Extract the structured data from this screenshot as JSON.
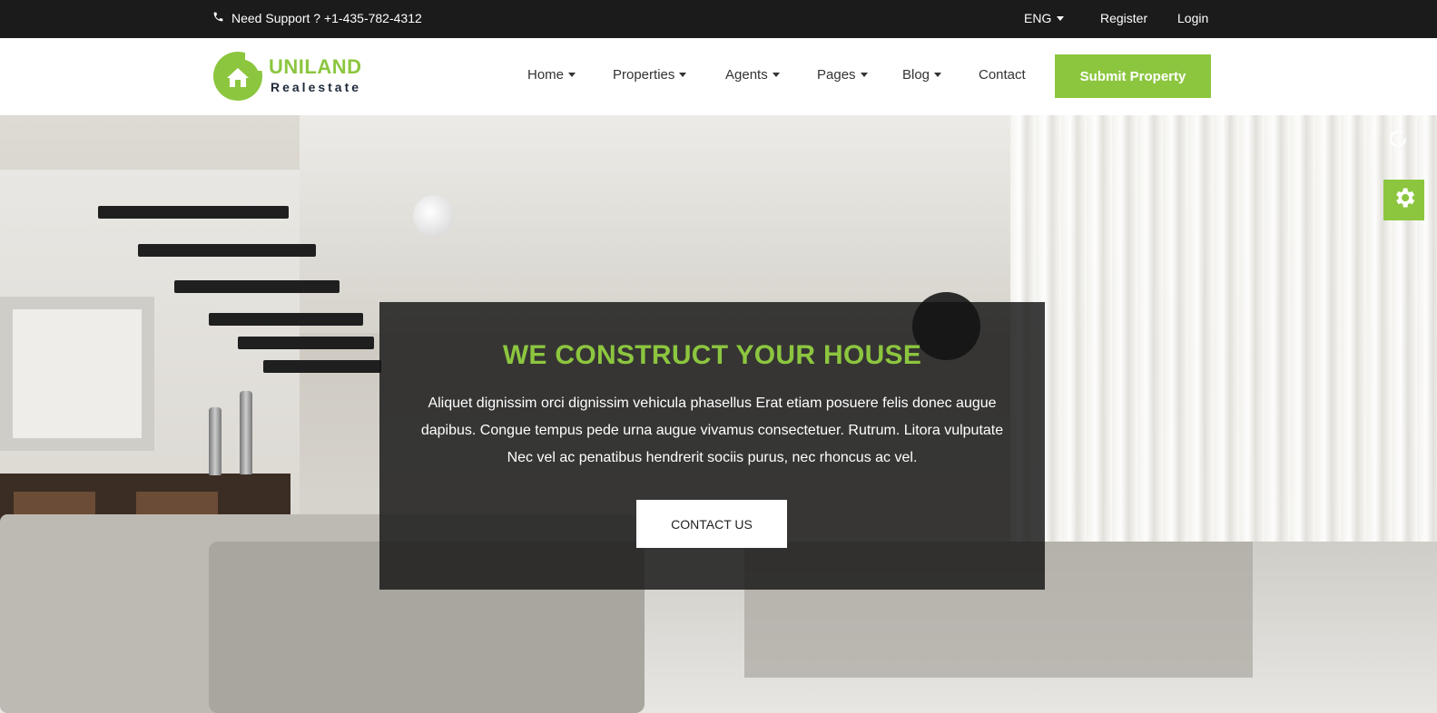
{
  "topbar": {
    "support_text": "Need Support ? +1-435-782-4312",
    "language": "ENG",
    "register": "Register",
    "login": "Login"
  },
  "logo": {
    "name": "UNILAND",
    "sub": "Realestate"
  },
  "nav": {
    "items": [
      {
        "label": "Home",
        "dropdown": true
      },
      {
        "label": "Properties",
        "dropdown": true
      },
      {
        "label": "Agents",
        "dropdown": true
      },
      {
        "label": "Pages",
        "dropdown": true
      },
      {
        "label": "Blog",
        "dropdown": true
      },
      {
        "label": "Contact",
        "dropdown": false
      }
    ],
    "submit_label": "Submit Property"
  },
  "hero": {
    "title": "WE CONSTRUCT YOUR HOUSE",
    "text": "Aliquet dignissim orci dignissim vehicula phasellus Erat etiam posuere felis donec augue dapibus. Congue tempus pede urna augue vivamus consectetuer. Rutrum. Litora vulputate Nec vel ac penatibus hendrerit sociis purus, nec rhoncus ac vel.",
    "button": "CONTACT US"
  },
  "icons": {
    "phone": "phone-icon",
    "reload": "reload-icon",
    "settings": "gear-icon",
    "logo": "house-icon"
  },
  "colors": {
    "accent": "#8cc63f",
    "topbar_bg": "#1b1b1b",
    "overlay_bg": "#141414"
  }
}
